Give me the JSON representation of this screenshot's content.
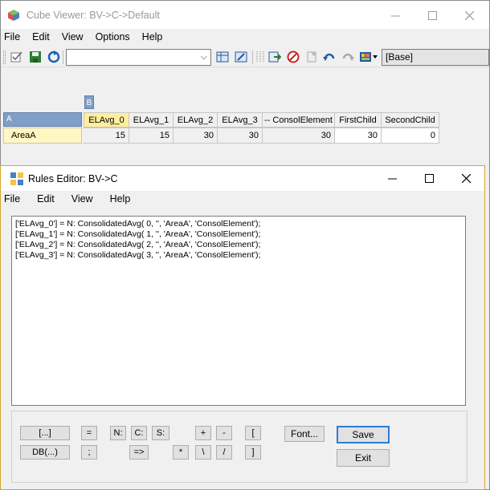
{
  "cube_viewer": {
    "title": "Cube Viewer: BV->C->Default",
    "menu": [
      "File",
      "Edit",
      "View",
      "Options",
      "Help"
    ],
    "view_combo_value": "",
    "subset_combo_value": "[Base]",
    "column_dim_tag": "B",
    "row_dim_tag": "A",
    "columns": [
      "ELAvg_0",
      "ELAvg_1",
      "ELAvg_2",
      "ELAvg_3",
      "-- ConsolElement",
      "FirstChild",
      "SecondChild"
    ],
    "row_label": "AreaA",
    "values": [
      "15",
      "15",
      "30",
      "30",
      "30",
      "30",
      "0"
    ],
    "accent_colors": {
      "dim_tag": "#7f9fc6",
      "selected_header": "#ffef9d",
      "row_label": "#fff7c2"
    }
  },
  "rules_editor": {
    "title": "Rules Editor:  BV->C",
    "menu": [
      "File",
      "Edit",
      "View",
      "Help"
    ],
    "rules_lines": [
      "['ELAvg_0'] = N: ConsolidatedAvg( 0, '', 'AreaA', 'ConsolElement');",
      "['ELAvg_1'] = N: ConsolidatedAvg( 1, '', 'AreaA', 'ConsolElement');",
      "['ELAvg_2'] = N: ConsolidatedAvg( 2, '', 'AreaA', 'ConsolElement');",
      "['ELAvg_3'] = N: ConsolidatedAvg( 3, '', 'AreaA', 'ConsolElement');"
    ],
    "buttons": {
      "bracket_ellipsis": "[...]",
      "db": "DB(...)",
      "equals": "=",
      "semicolon": ";",
      "n": "N:",
      "c": "C:",
      "s": "S:",
      "arrow": "=>",
      "plus": "+",
      "minus": "-",
      "multiply": "*",
      "backslash": "\\",
      "slash": "/",
      "open_bracket": "[",
      "close_bracket": "]",
      "font": "Font...",
      "save": "Save",
      "exit": "Exit"
    }
  }
}
